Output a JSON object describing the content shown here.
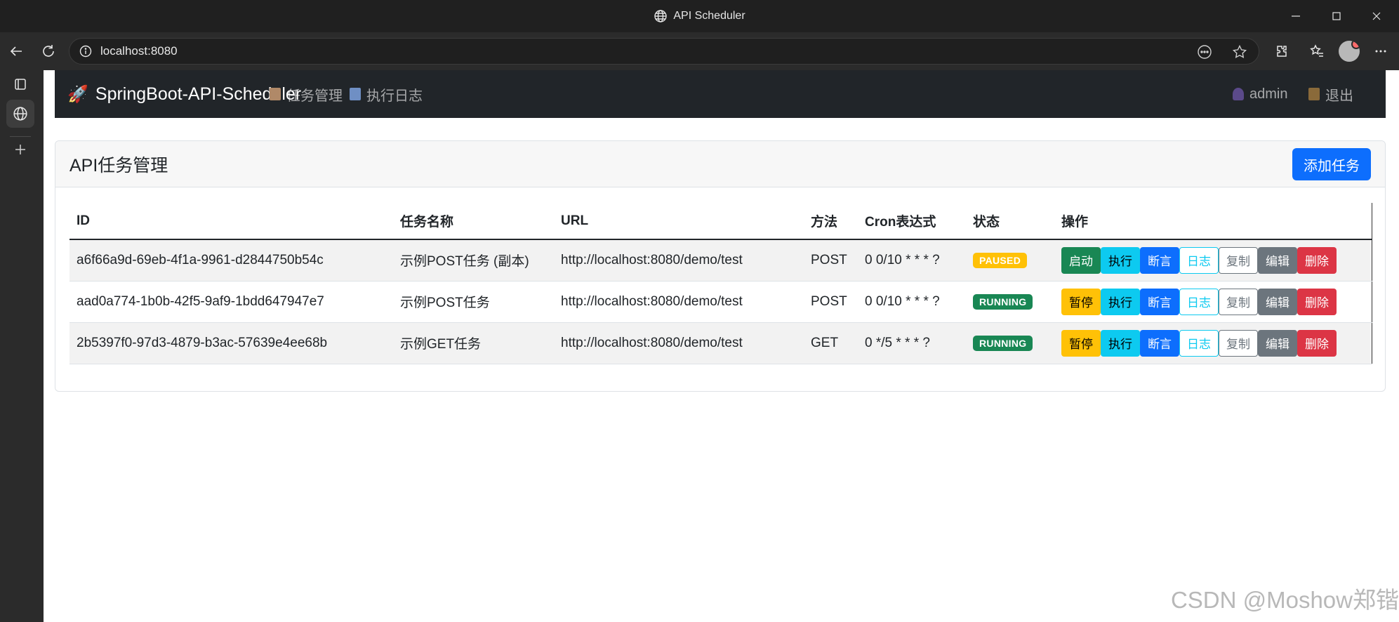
{
  "window": {
    "title": "API Scheduler"
  },
  "browser": {
    "url": "localhost:8080"
  },
  "app": {
    "brand": "SpringBoot-API-Scheduler",
    "brand_icon": "🚀",
    "nav": [
      {
        "label": "任务管理",
        "icon": "clipboard-icon",
        "color": "#b08968"
      },
      {
        "label": "执行日志",
        "icon": "bar-chart-icon",
        "color": "#6f8fc4"
      }
    ],
    "user": {
      "label": "admin",
      "icon": "user-icon"
    },
    "logout": {
      "label": "退出",
      "icon": "door-icon"
    }
  },
  "card": {
    "title": "API任务管理",
    "add_button": "添加任务"
  },
  "table": {
    "headers": [
      "ID",
      "任务名称",
      "URL",
      "方法",
      "Cron表达式",
      "状态",
      "操作"
    ],
    "rows": [
      {
        "id": "a6f66a9d-69eb-4f1a-9961-d2844750b54c",
        "name": "示例POST任务 (副本)",
        "url": "http://localhost:8080/demo/test",
        "method": "POST",
        "cron": "0 0/10 * * * ?",
        "status": "PAUSED",
        "toggle_label": "启动",
        "toggle_color": "#198754"
      },
      {
        "id": "aad0a774-1b0b-42f5-9af9-1bdd647947e7",
        "name": "示例POST任务",
        "url": "http://localhost:8080/demo/test",
        "method": "POST",
        "cron": "0 0/10 * * * ?",
        "status": "RUNNING",
        "toggle_label": "暂停",
        "toggle_color": "#ffc107"
      },
      {
        "id": "2b5397f0-97d3-4879-b3ac-57639e4ee68b",
        "name": "示例GET任务",
        "url": "http://localhost:8080/demo/test",
        "method": "GET",
        "cron": "0 */5 * * * ?",
        "status": "RUNNING",
        "toggle_label": "暂停",
        "toggle_color": "#ffc107"
      }
    ],
    "actions": {
      "execute": "执行",
      "assert": "断言",
      "log": "日志",
      "copy": "复制",
      "edit": "编辑",
      "delete": "删除"
    }
  },
  "watermark": "CSDN @Moshow郑锴",
  "colors": {
    "primary": "#0d6efd",
    "info": "#0dcaf0",
    "success": "#198754",
    "warning": "#ffc107",
    "secondary": "#6c757d",
    "danger": "#dc3545",
    "dark": "#212529"
  }
}
